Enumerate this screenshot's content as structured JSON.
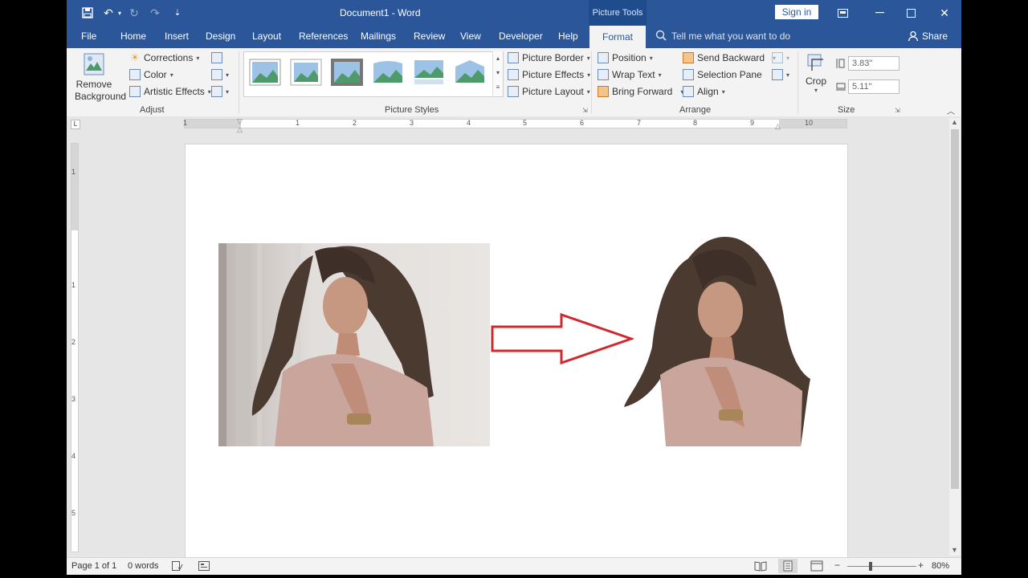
{
  "app": {
    "doc_title": "Document1",
    "separator": "-",
    "app_name": "Word",
    "context_header": "Picture Tools",
    "sign_in": "Sign in"
  },
  "tabs": [
    "File",
    "Home",
    "Insert",
    "Design",
    "Layout",
    "References",
    "Mailings",
    "Review",
    "View",
    "Developer",
    "Help"
  ],
  "active_tab": "Format",
  "tell_me": "Tell me what you want to do",
  "share": "Share",
  "ribbon": {
    "adjust": {
      "remove_bg_line1": "Remove",
      "remove_bg_line2": "Background",
      "corrections": "Corrections",
      "color": "Color",
      "artistic": "Artistic Effects",
      "label": "Adjust"
    },
    "styles": {
      "border": "Picture Border",
      "effects": "Picture Effects",
      "layout": "Picture Layout",
      "label": "Picture Styles"
    },
    "arrange": {
      "position": "Position",
      "wrap": "Wrap Text",
      "bring_forward": "Bring Forward",
      "send_backward": "Send Backward",
      "selection_pane": "Selection Pane",
      "align": "Align",
      "label": "Arrange"
    },
    "size": {
      "crop": "Crop",
      "height": "3.83\"",
      "width": "5.11\"",
      "label": "Size"
    }
  },
  "ruler_numbers": [
    "1",
    "1",
    "2",
    "3",
    "4",
    "5",
    "6",
    "7",
    "8",
    "9",
    "10"
  ],
  "vruler_numbers": [
    "1",
    "1",
    "2",
    "3",
    "4",
    "5"
  ],
  "status": {
    "page": "Page 1 of 1",
    "words": "0 words",
    "zoom": "80%"
  },
  "colors": {
    "brand": "#2b579a",
    "arrow": "#d0282c"
  }
}
